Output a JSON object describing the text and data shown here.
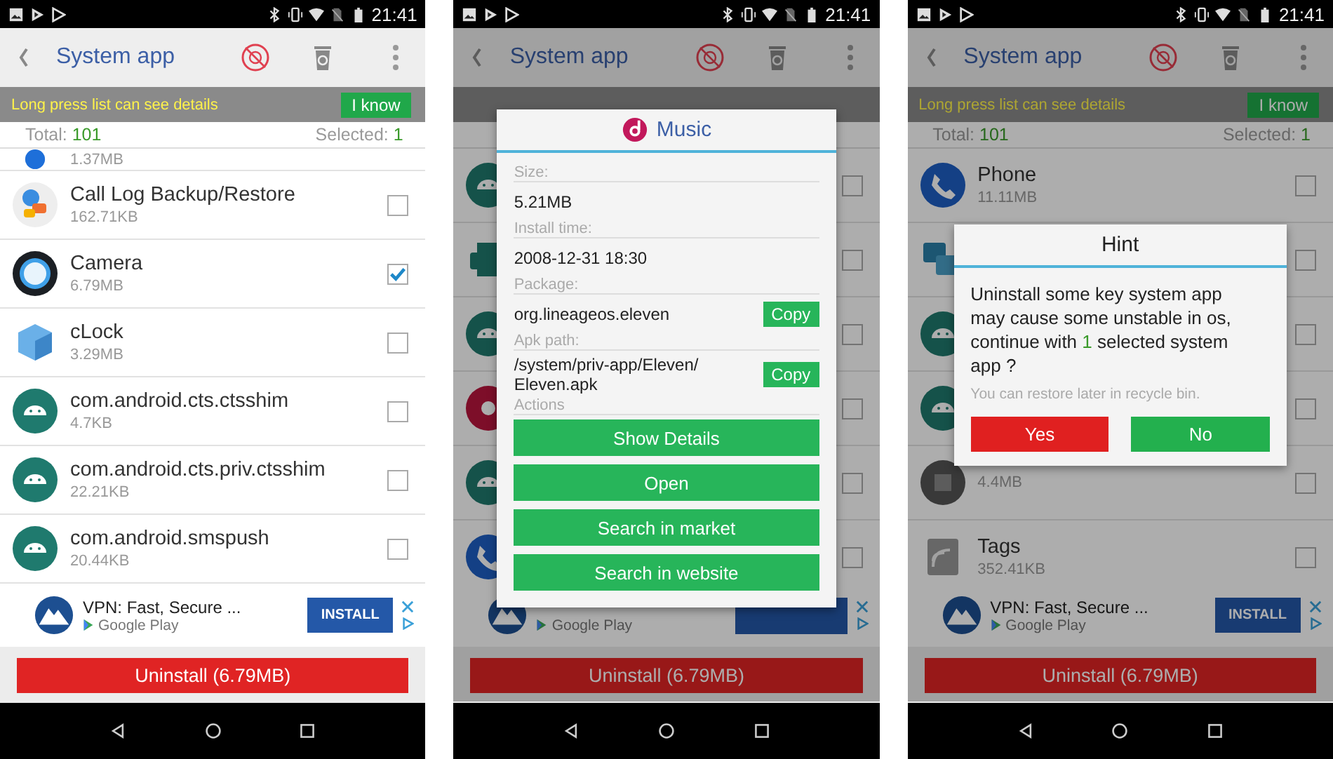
{
  "screens": [
    {
      "status_bar": {
        "time": "21:41"
      },
      "toolbar": {
        "title": "System app"
      },
      "banner": {
        "text": "Long press list can see details",
        "button": "I know"
      },
      "summary": {
        "total_label": "Total:",
        "total": "101",
        "selected_label": "Selected:",
        "selected": "1"
      },
      "list_top_partial": {
        "kind": "blue-circle",
        "size": "1.37MB"
      },
      "apps": [
        {
          "kind": "call-log",
          "name": "Call Log Backup/Restore",
          "size": "162.71KB",
          "checked": false
        },
        {
          "kind": "camera",
          "name": "Camera",
          "size": "6.79MB",
          "checked": true
        },
        {
          "kind": "cube",
          "name": "cLock",
          "size": "3.29MB",
          "checked": false
        },
        {
          "kind": "android",
          "name": "com.android.cts.ctsshim",
          "size": "4.7KB",
          "checked": false
        },
        {
          "kind": "android",
          "name": "com.android.cts.priv.ctsshim",
          "size": "22.21KB",
          "checked": false
        },
        {
          "kind": "android",
          "name": "com.android.smspush",
          "size": "20.44KB",
          "checked": false
        }
      ],
      "ad": {
        "title": "VPN: Fast, Secure ...",
        "store": "Google Play",
        "button": "INSTALL"
      },
      "uninstall": "Uninstall (6.79MB)"
    },
    {
      "status_bar": {
        "time": "21:41"
      },
      "toolbar": {
        "title": "System app"
      },
      "apps": [
        {
          "kind": "android",
          "checked": false
        },
        {
          "kind": "printer",
          "checked": false
        },
        {
          "kind": "android",
          "checked": false
        },
        {
          "kind": "music",
          "checked": false
        },
        {
          "kind": "android",
          "checked": false
        },
        {
          "kind": "phone",
          "checked": false
        }
      ],
      "ad": {
        "store": "Google Play"
      },
      "uninstall": "Uninstall (6.79MB)",
      "dialog": {
        "kind": "details",
        "title": "Music",
        "fields": [
          {
            "label": "Size:",
            "value": "5.21MB"
          },
          {
            "label": "Install time:",
            "value": "2008-12-31 18:30"
          },
          {
            "label": "Package:",
            "value": "org.lineageos.eleven",
            "action": "Copy"
          },
          {
            "label": "Apk path:",
            "value": "/system/priv-app/Eleven/ Eleven.apk",
            "action": "Copy"
          }
        ],
        "actions_label": "Actions",
        "actions": [
          "Show Details",
          "Open",
          "Search in market",
          "Search in website"
        ]
      }
    },
    {
      "status_bar": {
        "time": "21:41"
      },
      "toolbar": {
        "title": "System app"
      },
      "banner": {
        "text": "Long press list can see details",
        "button": "I know"
      },
      "summary": {
        "total_label": "Total:",
        "total": "101",
        "selected_label": "Selected:",
        "selected": "1"
      },
      "apps": [
        {
          "kind": "phone",
          "name": "Phone",
          "size": "11.11MB",
          "checked": false
        },
        {
          "kind": "squares",
          "checked": false
        },
        {
          "kind": "android",
          "checked": false
        },
        {
          "kind": "android",
          "checked": false
        },
        {
          "kind": "grey-circle",
          "size": "4.4MB",
          "checked": false
        },
        {
          "kind": "tags",
          "name": "Tags",
          "size": "352.41KB",
          "checked": false
        }
      ],
      "ad": {
        "title": "VPN: Fast, Secure ...",
        "store": "Google Play",
        "button": "INSTALL"
      },
      "uninstall": "Uninstall (6.79MB)",
      "dialog": {
        "kind": "hint",
        "title": "Hint",
        "text_before": "Uninstall some key system app may cause some unstable in os, continue with ",
        "count": "1",
        "text_after": " selected system app ?",
        "note": "You can restore later in recycle bin.",
        "buttons": [
          {
            "label": "Yes",
            "color": "#e02020"
          },
          {
            "label": "No",
            "color": "#23b04e"
          }
        ]
      }
    }
  ]
}
